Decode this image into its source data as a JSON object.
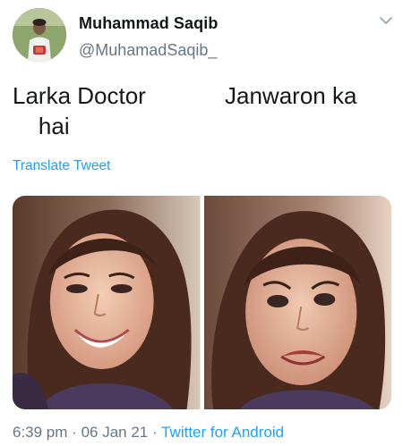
{
  "user": {
    "display_name": "Muhammad Saqib",
    "handle": "@MuhamadSaqib_",
    "avatar_icon": "profile-avatar"
  },
  "tweet": {
    "text_left": "Larka Doctor\n    hai",
    "text_right": "Janwaron ka",
    "translate_label": "Translate Tweet"
  },
  "media": {
    "left_photo": "smiling-woman-photo",
    "right_photo": "crying-woman-photo"
  },
  "meta": {
    "time": "6:39 pm",
    "date": "06 Jan 21",
    "separator": "·",
    "source": "Twitter for Android"
  },
  "colors": {
    "link": "#1da1f2",
    "secondary": "#657786",
    "primary_text": "#14171a"
  }
}
